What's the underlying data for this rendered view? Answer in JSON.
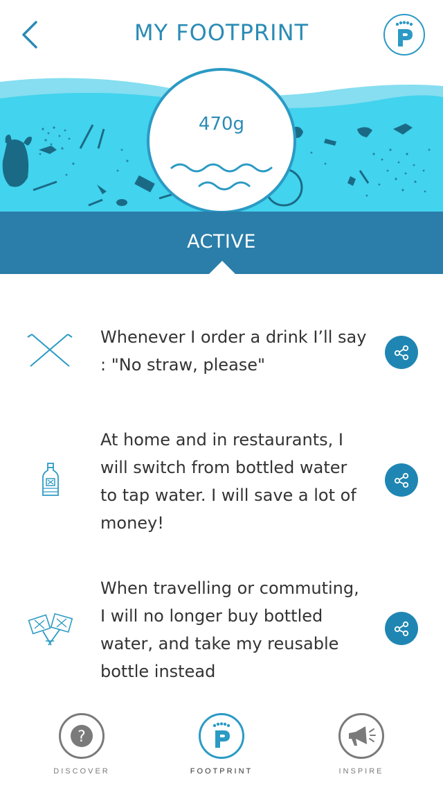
{
  "header": {
    "title": "MY FOOTPRINT",
    "back_icon": "chevron-left-icon",
    "profile_icon": "footprint-logo-icon"
  },
  "banner": {
    "weight": "470g",
    "water_color": "#42d3ee",
    "deep_water_color": "#1a6a86"
  },
  "status": {
    "label": "ACTIVE",
    "color": "#2a7ea9"
  },
  "pledges": [
    {
      "icon": "straws-icon",
      "text": "Whenever I order a drink I’ll say : \"No straw, please\""
    },
    {
      "icon": "water-bottle-icon",
      "text": "At home and in restaurants, I will switch from bottled water to tap water. I will save a lot of money!"
    },
    {
      "icon": "protest-signs-icon",
      "text": "When travelling or commuting, I will no longer buy bottled water, and take my reusable bottle instead"
    }
  ],
  "share_icon": "share-icon",
  "bottom_nav": [
    {
      "label": "DISCOVER",
      "icon": "question-icon",
      "active": false
    },
    {
      "label": "FOOTPRINT",
      "icon": "footprint-logo-icon",
      "active": true
    },
    {
      "label": "INSPIRE",
      "icon": "megaphone-icon",
      "active": false
    }
  ],
  "colors": {
    "accent": "#2b9ac4",
    "title": "#2b8bb5",
    "share_button": "#1f86b3"
  }
}
